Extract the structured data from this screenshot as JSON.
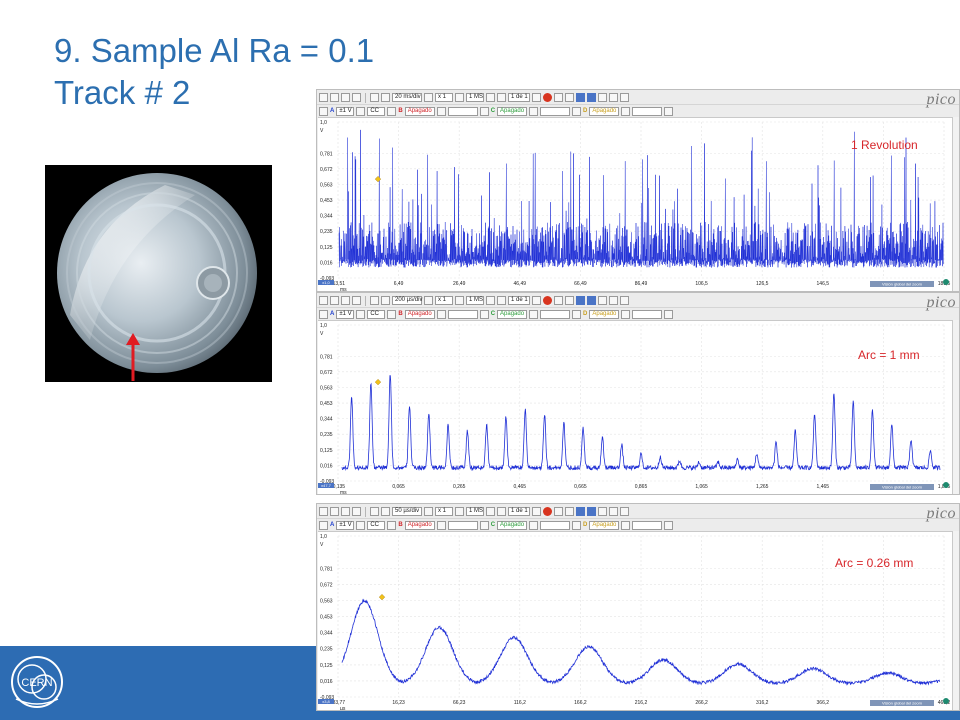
{
  "slide": {
    "title_line1": "9. Sample Al Ra = 0.1",
    "title_line2": "Track # 2",
    "logo_text": "CERN"
  },
  "colors": {
    "title": "#2c6fb0",
    "footer": "#2d6cb3",
    "trace": "#1f2fd6",
    "annotation": "#d7262a"
  },
  "toolbar_common": {
    "multiplier": "x 1",
    "samples": "1 MS",
    "page": "1 de 1",
    "brand": "pico",
    "range": "±1 V",
    "coupling": "CC",
    "off": "Apagado",
    "ch_a": "A",
    "ch_b": "B",
    "ch_c": "C",
    "ch_d": "D",
    "overview_label": "Visión global del zoom"
  },
  "scopes": [
    {
      "timebase": "20 ms/div",
      "annotation": "1 Revolution",
      "y_unit": "V",
      "x_unit": "ms",
      "y_ticks": [
        "1,0",
        "0,781",
        "0,672",
        "0,563",
        "0,453",
        "0,344",
        "0,235",
        "0,125",
        "0,016",
        "-0,093"
      ],
      "x_ticks": [
        "-13,51",
        "6,49",
        "26,49",
        "46,49",
        "66,49",
        "86,49",
        "106,5",
        "126,5",
        "146,5",
        "166,5",
        "186,5"
      ],
      "zoom_badge": "x1,0"
    },
    {
      "timebase": "200 µs/div",
      "annotation": "Arc = 1 mm",
      "y_unit": "V",
      "x_unit": "ms",
      "y_ticks": [
        "1,0",
        "0,781",
        "0,672",
        "0,563",
        "0,453",
        "0,344",
        "0,235",
        "0,125",
        "0,016",
        "-0,093"
      ],
      "x_ticks": [
        "-0,135",
        "0,065",
        "0,265",
        "0,465",
        "0,665",
        "0,865",
        "1,065",
        "1,265",
        "1,465",
        "1,665",
        "1,865"
      ],
      "zoom_badge": "x47,7"
    },
    {
      "timebase": "50 µs/div",
      "annotation": "Arc = 0.26 mm",
      "y_unit": "V",
      "x_unit": "µs",
      "y_ticks": [
        "1,0",
        "0,781",
        "0,672",
        "0,563",
        "0,453",
        "0,344",
        "0,235",
        "0,125",
        "0,016",
        "-0,093"
      ],
      "x_ticks": [
        "-33,77",
        "16,23",
        "66,23",
        "116,2",
        "166,2",
        "216,2",
        "266,2",
        "316,2",
        "366,2",
        "416,2",
        "466,2"
      ],
      "zoom_badge": "x3,8"
    }
  ]
}
